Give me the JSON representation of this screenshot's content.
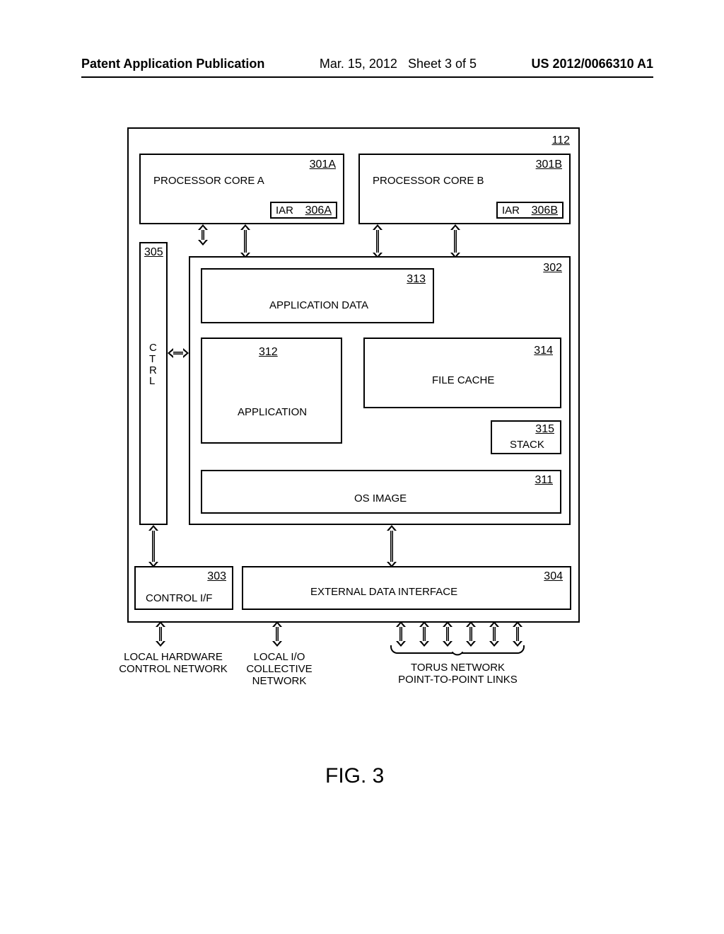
{
  "header": {
    "left": "Patent Application Publication",
    "date": "Mar. 15, 2012",
    "sheet": "Sheet 3 of 5",
    "right": "US 2012/0066310 A1"
  },
  "refs": {
    "main": "112",
    "coreA": "301A",
    "coreB": "301B",
    "iarA": "306A",
    "iarB": "306B",
    "ctrl": "305",
    "mem": "302",
    "appdata": "313",
    "app": "312",
    "filecache": "314",
    "stack": "315",
    "osimage": "311",
    "ctrlif": "303",
    "extdata": "304"
  },
  "labels": {
    "coreA": "PROCESSOR CORE A",
    "coreB": "PROCESSOR CORE B",
    "iar": "IAR",
    "ctrl": "CTRL",
    "appdata": "APPLICATION DATA",
    "app": "APPLICATION",
    "filecache": "FILE CACHE",
    "stack": "STACK",
    "osimage": "OS IMAGE",
    "ctrlif": "CONTROL I/F",
    "extdata": "EXTERNAL DATA INTERFACE",
    "localhw1": "LOCAL HARDWARE",
    "localhw2": "CONTROL NETWORK",
    "localio1": "LOCAL I/O",
    "localio2": "COLLECTIVE",
    "localio3": "NETWORK",
    "torus1": "TORUS NETWORK",
    "torus2": "POINT-TO-POINT LINKS"
  },
  "figure": "FIG. 3"
}
